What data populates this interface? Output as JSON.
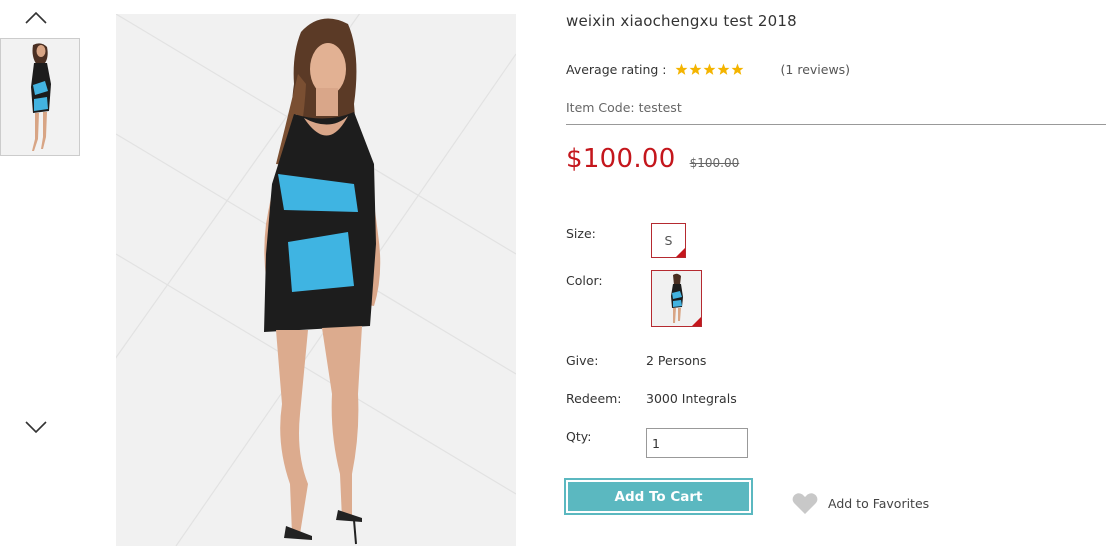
{
  "product": {
    "title": "weixin xiaochengxu test 2018",
    "rating_label": "Average rating :",
    "rating_stars": 5,
    "reviews": "(1 reviews)",
    "item_code": "Item Code: testest",
    "price": "$100.00",
    "old_price": "$100.00"
  },
  "options": {
    "size_label": "Size:",
    "size_value": "S",
    "color_label": "Color:",
    "give_label": "Give:",
    "give_value": "2 Persons",
    "redeem_label": "Redeem:",
    "redeem_value": "3000 Integrals",
    "qty_label": "Qty:",
    "qty_value": "1"
  },
  "actions": {
    "add_to_cart": "Add To Cart",
    "add_to_favorites": "Add to Favorites"
  },
  "colors": {
    "price_red": "#c4161c",
    "accent_teal": "#5bb8c0",
    "star_gold": "#f4b400",
    "selected_border": "#b52a30"
  },
  "icons": {
    "up": "chevron-up-icon",
    "down": "chevron-down-icon",
    "star": "star-icon",
    "heart": "heart-icon"
  }
}
